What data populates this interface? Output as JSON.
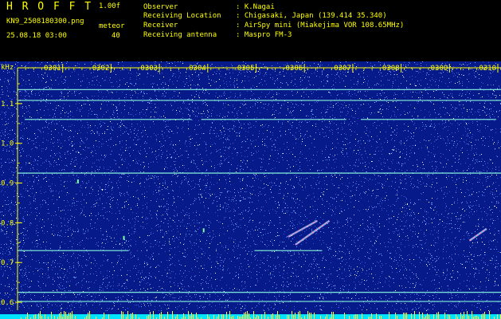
{
  "header": {
    "app_name": "H R O F F T",
    "version": "1.00f",
    "filename": "KN9_2508180300.png",
    "datetime": "25.08.18 03:00",
    "meteor_label": "meteor",
    "meteor_count": "40",
    "fields": [
      {
        "label": "Observer",
        "value": ": K.Nagai"
      },
      {
        "label": "Receiving Location",
        "value": ": Chigasaki, Japan (139.414 35.340)"
      },
      {
        "label": "Receiver",
        "value": ": AirSpy mini (Miakejima VOR 108.65MHz)"
      },
      {
        "label": "Receiving antenna",
        "value": ": Maspro FM-3"
      }
    ]
  },
  "chart_data": {
    "type": "heatmap",
    "ylabel": "kHz",
    "ylim": [
      0.58,
      1.19
    ],
    "yticks": [
      "1.1",
      "1.0",
      "0.9",
      "0.8",
      "0.7",
      "0.6"
    ],
    "x_labels": [
      "0301",
      "0302",
      "0303",
      "0304",
      "0305",
      "0306",
      "0307",
      "0308",
      "0309",
      "0310"
    ],
    "xlim": [
      0.0,
      10.0
    ],
    "colors": {
      "background": "#071a8a",
      "noise": [
        "#3a5bd8",
        "#6fa0ff",
        "#ffffff",
        "#a0c8ff"
      ],
      "carrier": "#7fe8d8",
      "meteor": "#ff7fd0",
      "axis": "#ffff00",
      "bottom_band": "#00e5ff"
    },
    "carriers": [
      {
        "freq": 1.135,
        "start": 0.0,
        "end": 10.0
      },
      {
        "freq": 1.108,
        "start": 0.0,
        "end": 10.0
      },
      {
        "freq": 1.06,
        "start": 0.15,
        "end": 3.6
      },
      {
        "freq": 1.06,
        "start": 3.8,
        "end": 6.8
      },
      {
        "freq": 1.06,
        "start": 7.1,
        "end": 9.9
      },
      {
        "freq": 0.925,
        "start": 0.0,
        "end": 10.0
      },
      {
        "freq": 0.73,
        "start": 0.0,
        "end": 2.3
      },
      {
        "freq": 0.73,
        "start": 4.9,
        "end": 6.3
      },
      {
        "freq": 0.625,
        "start": 0.0,
        "end": 10.0
      },
      {
        "freq": 0.602,
        "start": 0.0,
        "end": 10.0
      }
    ],
    "meteors": [
      {
        "t0": 5.6,
        "f0": 0.765,
        "t1": 6.2,
        "f1": 0.805
      },
      {
        "t0": 5.75,
        "f0": 0.745,
        "t1": 6.45,
        "f1": 0.805
      },
      {
        "t0": 9.35,
        "f0": 0.755,
        "t1": 9.7,
        "f1": 0.785
      }
    ],
    "pings": [
      {
        "t": 2.2,
        "f": 0.763
      },
      {
        "t": 3.85,
        "f": 0.782
      },
      {
        "t": 1.25,
        "f": 0.905
      }
    ]
  }
}
